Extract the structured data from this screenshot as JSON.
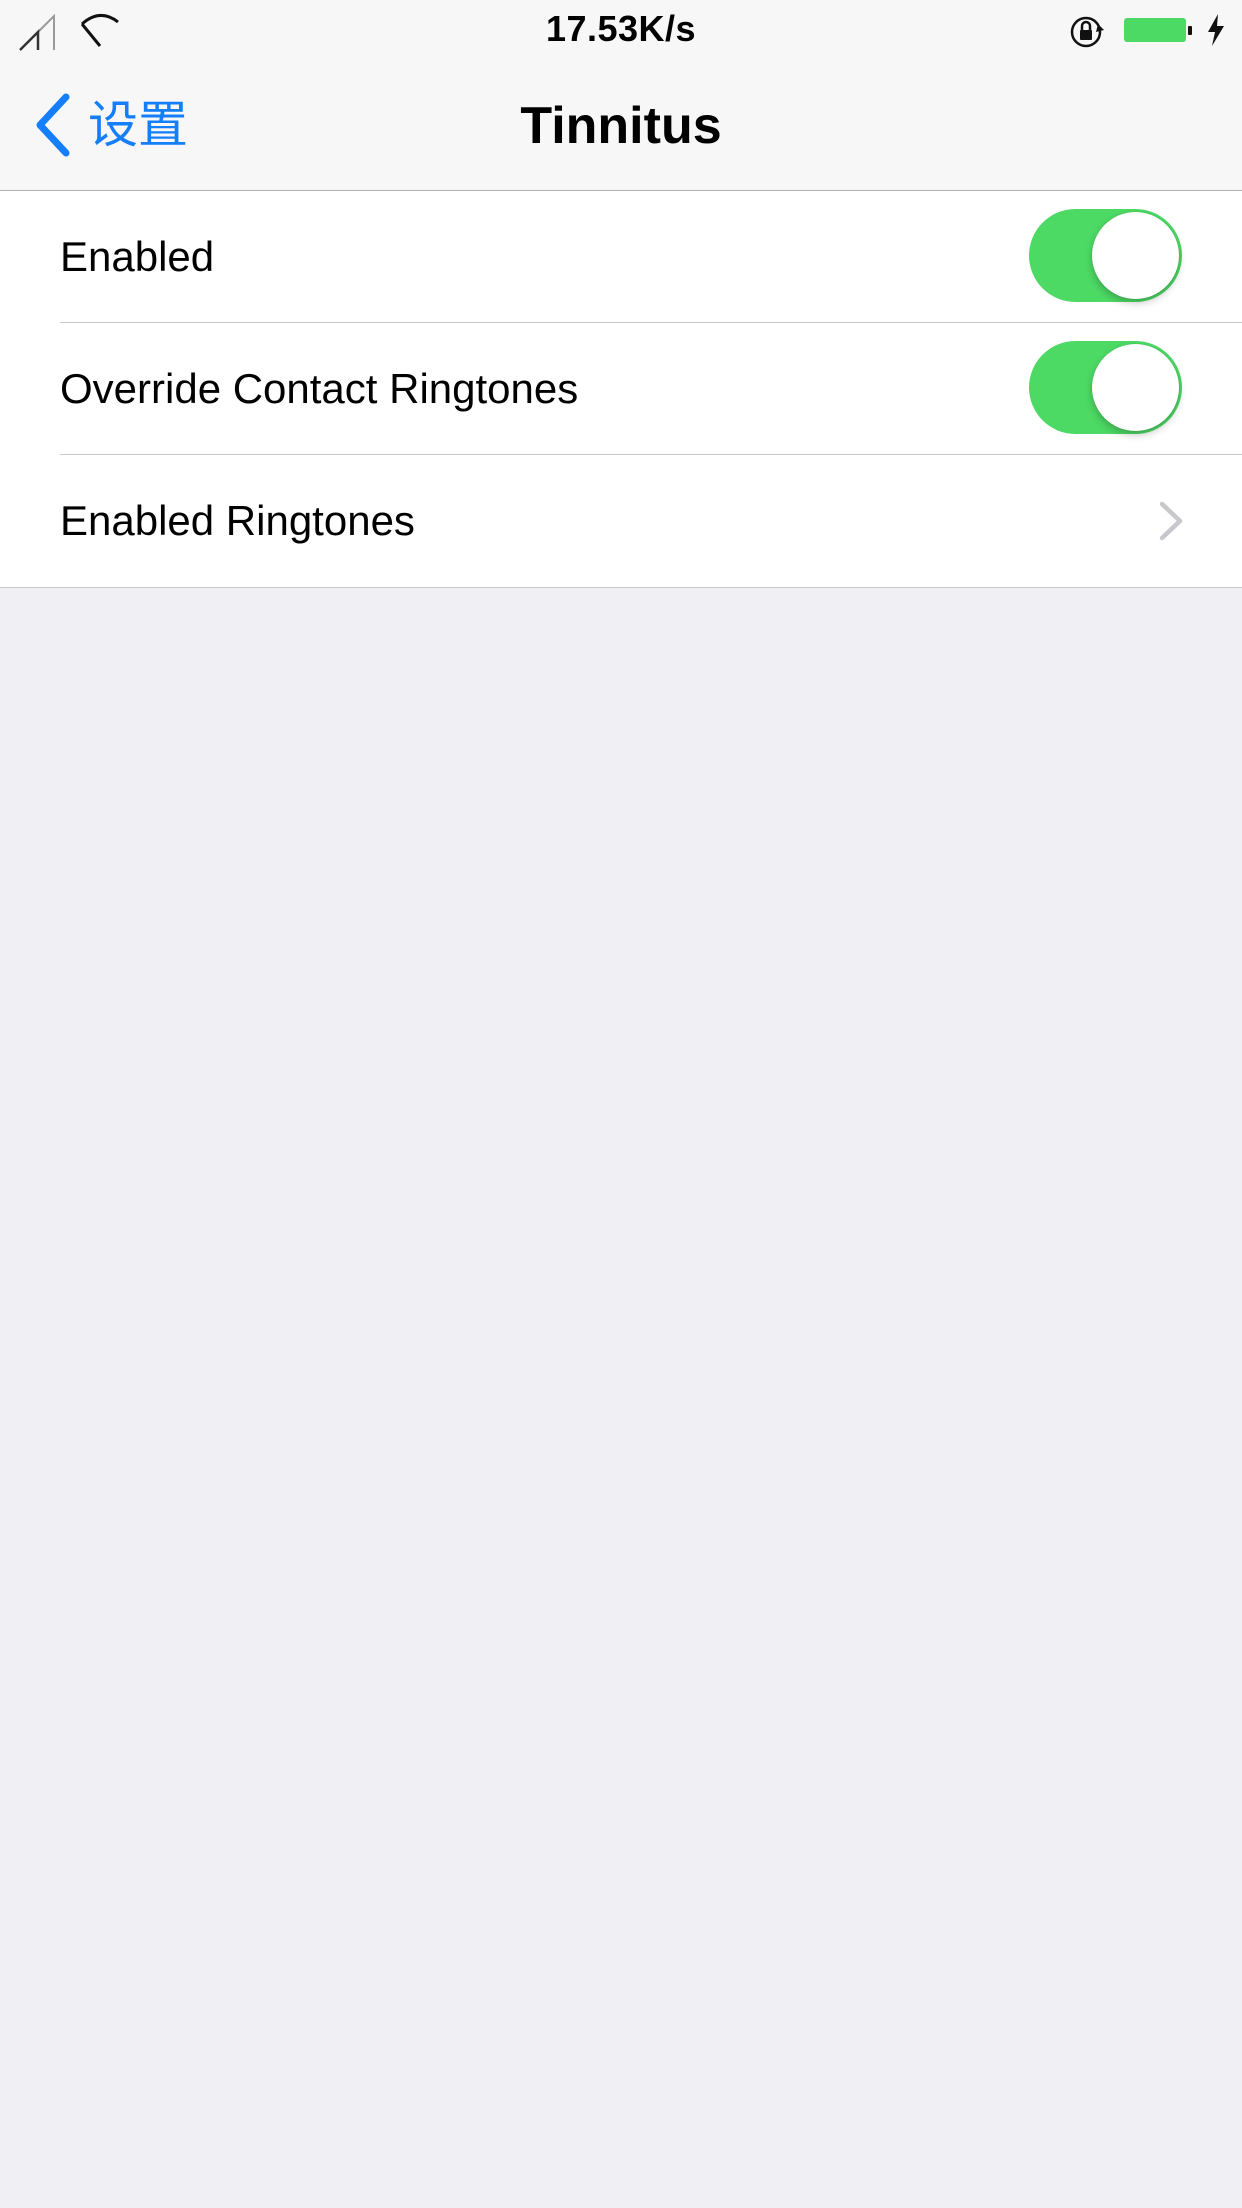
{
  "status_bar": {
    "network_speed": "17.53K/s",
    "icons": [
      "signal-icon",
      "wifi-icon",
      "rotation-lock-icon",
      "battery-icon",
      "charging-icon"
    ],
    "battery_color": "#4cd964"
  },
  "nav": {
    "back_label": "设置",
    "title": "Tinnitus",
    "accent_color": "#147efb"
  },
  "settings": {
    "rows": [
      {
        "label": "Enabled",
        "type": "toggle",
        "on": true
      },
      {
        "label": "Override Contact Ringtones",
        "type": "toggle",
        "on": true
      },
      {
        "label": "Enabled Ringtones",
        "type": "disclosure"
      }
    ],
    "switch_on_color": "#4cd964"
  }
}
